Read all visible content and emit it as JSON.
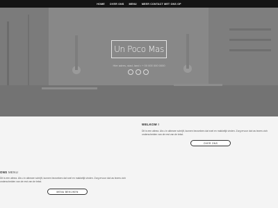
{
  "nav": {
    "items": [
      "HOME",
      "OVER ONS",
      "MENU",
      "MEER CONTACT MET ONS OP"
    ]
  },
  "hero": {
    "logo": "Un Poco Mas",
    "subtitle": "Hier adres, stad, land   •   + 00 000 000 0000",
    "social_icons": [
      "facebook-icon",
      "instagram-icon",
      "tripadvisor-icon"
    ]
  },
  "welkom": {
    "title": "WELKOM !",
    "body": "Dit is een alinea. Als u in alineare schrijft, kunnen bezoekers dat snel en makkelijk vinden. Zorg ervoor dat uw lezers zich onderscheiden van de rest van de tekst.",
    "button": "OVER ONS"
  },
  "menu_section": {
    "title_bold": "ONS",
    "title_light": "MENU",
    "body": "Dit is een alinea. Als u in alineare schrijft, kunnen bezoekers dat snel en makkelijk vinden. Zorg ervoor dat uw lezers zich onderscheiden van de rest van de tekst.",
    "button": "MENU BEKIJKEN"
  },
  "colors": {
    "nav_bg": "#141414",
    "hero_overlay": "#808080",
    "page_bg": "#f4f4f4"
  }
}
